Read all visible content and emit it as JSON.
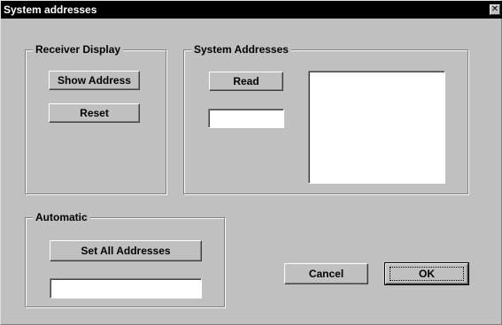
{
  "window": {
    "title": "System addresses",
    "close_glyph": "✕"
  },
  "receiver_display": {
    "legend": "Receiver Display",
    "show_address_label": "Show Address",
    "reset_label": "Reset"
  },
  "system_addresses": {
    "legend": "System Addresses",
    "read_label": "Read",
    "address_field_value": "",
    "address_list": []
  },
  "automatic": {
    "legend": "Automatic",
    "set_all_label": "Set All Addresses",
    "status_field_value": ""
  },
  "dialog_buttons": {
    "cancel_label": "Cancel",
    "ok_label": "OK"
  }
}
